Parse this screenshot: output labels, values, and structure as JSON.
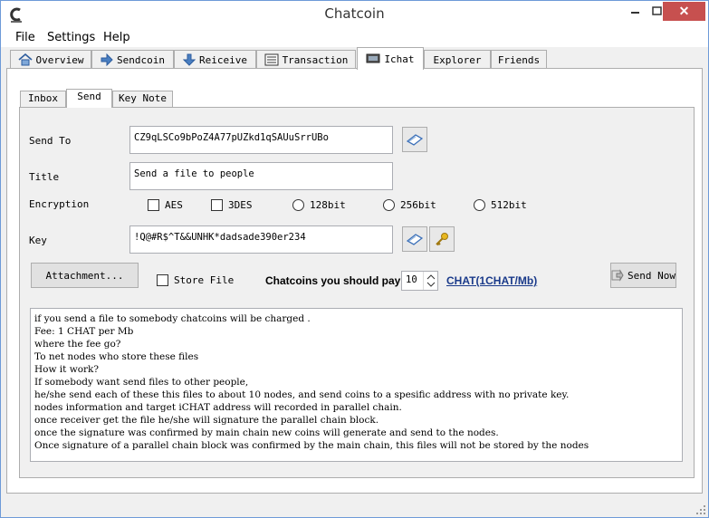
{
  "window": {
    "title": "Chatcoin",
    "close_glyph": "✕"
  },
  "menu": [
    "File",
    "Settings",
    "Help"
  ],
  "tabs": [
    {
      "label": "Overview",
      "icon": "home-icon"
    },
    {
      "label": "Sendcoin",
      "icon": "send-arrow-icon"
    },
    {
      "label": "Reiceive",
      "icon": "receive-arrow-icon"
    },
    {
      "label": "Transaction",
      "icon": "list-icon"
    },
    {
      "label": "Ichat",
      "icon": "chat-icon"
    },
    {
      "label": "Explorer",
      "icon": ""
    },
    {
      "label": "Friends",
      "icon": ""
    }
  ],
  "subtabs": [
    "Inbox",
    "Send",
    "Key Note"
  ],
  "form": {
    "send_to_label": "Send To",
    "send_to_value": "CZ9qLSCo9bPoZ4A77pUZkd1qSAUuSrrUBo",
    "title_label": "Title",
    "title_value": "Send a file to people",
    "encryption_label": "Encryption",
    "encryption_options": [
      "AES",
      "3DES",
      "128bit",
      "256bit",
      "512bit"
    ],
    "key_label": "Key",
    "key_value": "!Q@#R$^T&&UNHK*dadsade390er234",
    "attachment_button": "Attachment...",
    "store_file_label": "Store File",
    "pay_label": "Chatcoins you should pay:",
    "pay_value": "10",
    "pay_rate_link": "CHAT(1CHAT/Mb)",
    "send_now_button": "Send Now"
  },
  "notes": [
    "if you send a file to somebody chatcoins will be charged .",
    "Fee: 1 CHAT per Mb",
    "where the fee go?",
    "To net nodes who store these files",
    "How it work?",
    "If somebody want send files to other people,",
    "he/she send each of these this files to about 10 nodes, and send coins to a spesific address with no private key.",
    "nodes information and target iCHAT address will recorded in parallel chain.",
    "once receiver get the file he/she will signature the parallel chain block.",
    "once the signature was confirmed by main chain new coins will generate and send to the nodes.",
    "Once signature of a parallel chain block was confirmed by the main chain, this files will not be stored by the nodes"
  ],
  "colors": {
    "accent": "#c7504f",
    "link": "#1a3a8a",
    "border": "#adadad"
  }
}
